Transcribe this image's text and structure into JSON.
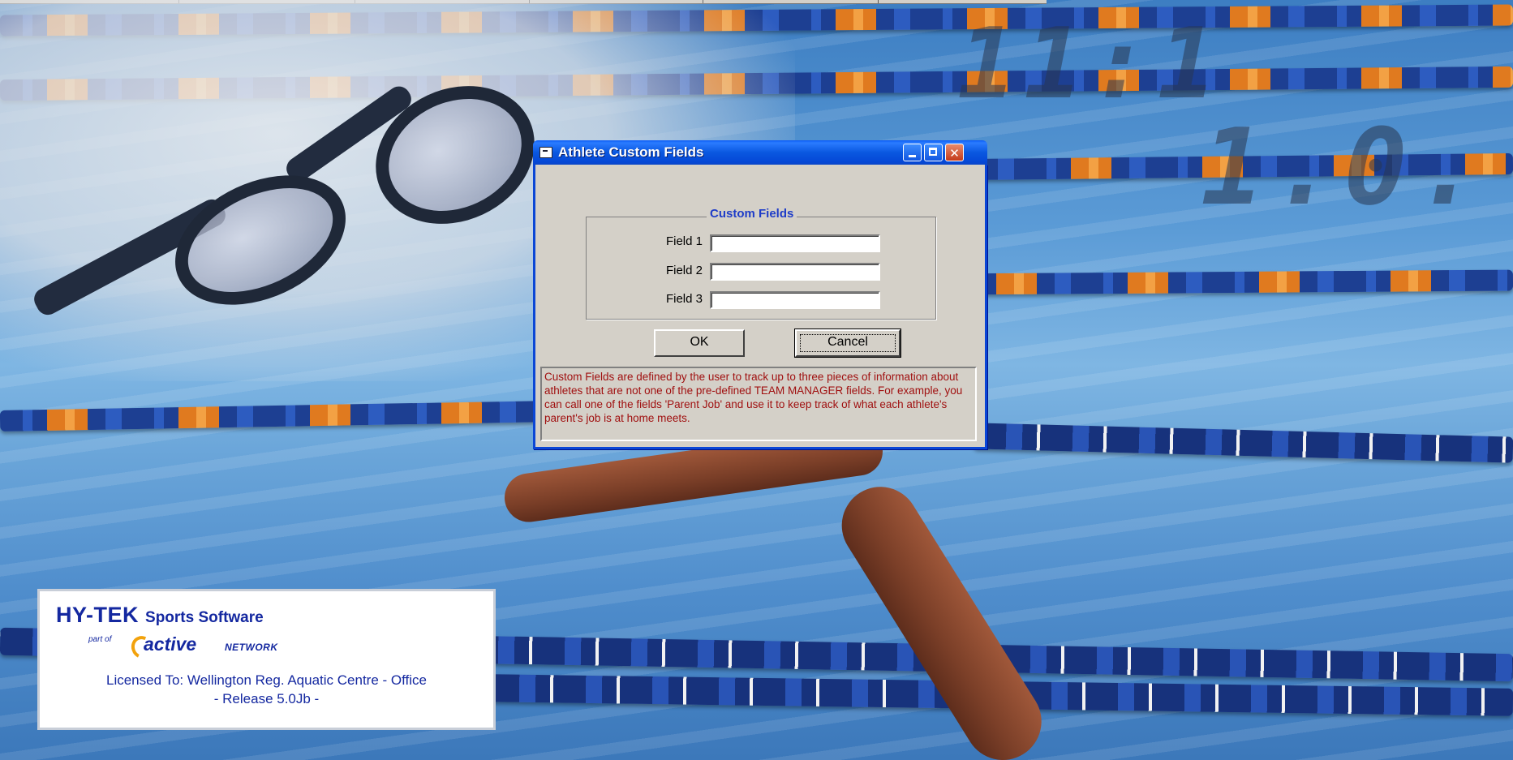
{
  "dialog": {
    "title": "Athlete Custom Fields",
    "group_title": "Custom Fields",
    "fields": [
      {
        "label": "Field 1",
        "value": ""
      },
      {
        "label": "Field 2",
        "value": ""
      },
      {
        "label": "Field 3",
        "value": ""
      }
    ],
    "ok_label": "OK",
    "cancel_label": "Cancel",
    "help_text": "Custom Fields are defined by the user to track up to three pieces of information about athletes that are not one of the pre-defined TEAM MANAGER fields. For example, you can call one of the fields 'Parent Job' and use it to keep track of what each athlete's parent's job is at home meets.",
    "title_buttons": {
      "minimize": "minimize-icon",
      "maximize": "maximize-icon",
      "close": "close-icon",
      "close_glyph": "✕"
    }
  },
  "background": {
    "clock_digits_top": "11:1",
    "clock_digits_bottom": "1.0."
  },
  "license": {
    "brand_main": "HY-TEK",
    "brand_sub": "Sports Software",
    "part_of": "part of",
    "active": "active",
    "network": "NETWORK",
    "licensed_to": "Licensed To:  Wellington Reg. Aquatic Centre - Office",
    "release": "- Release 5.0Jb -"
  },
  "colors": {
    "title_bar": "#0a58e0",
    "dialog_face": "#d4d0c8",
    "group_title": "#1e3cc8",
    "help_text": "#a01010",
    "brand": "#1428a0",
    "active_accent": "#f2a20c"
  }
}
